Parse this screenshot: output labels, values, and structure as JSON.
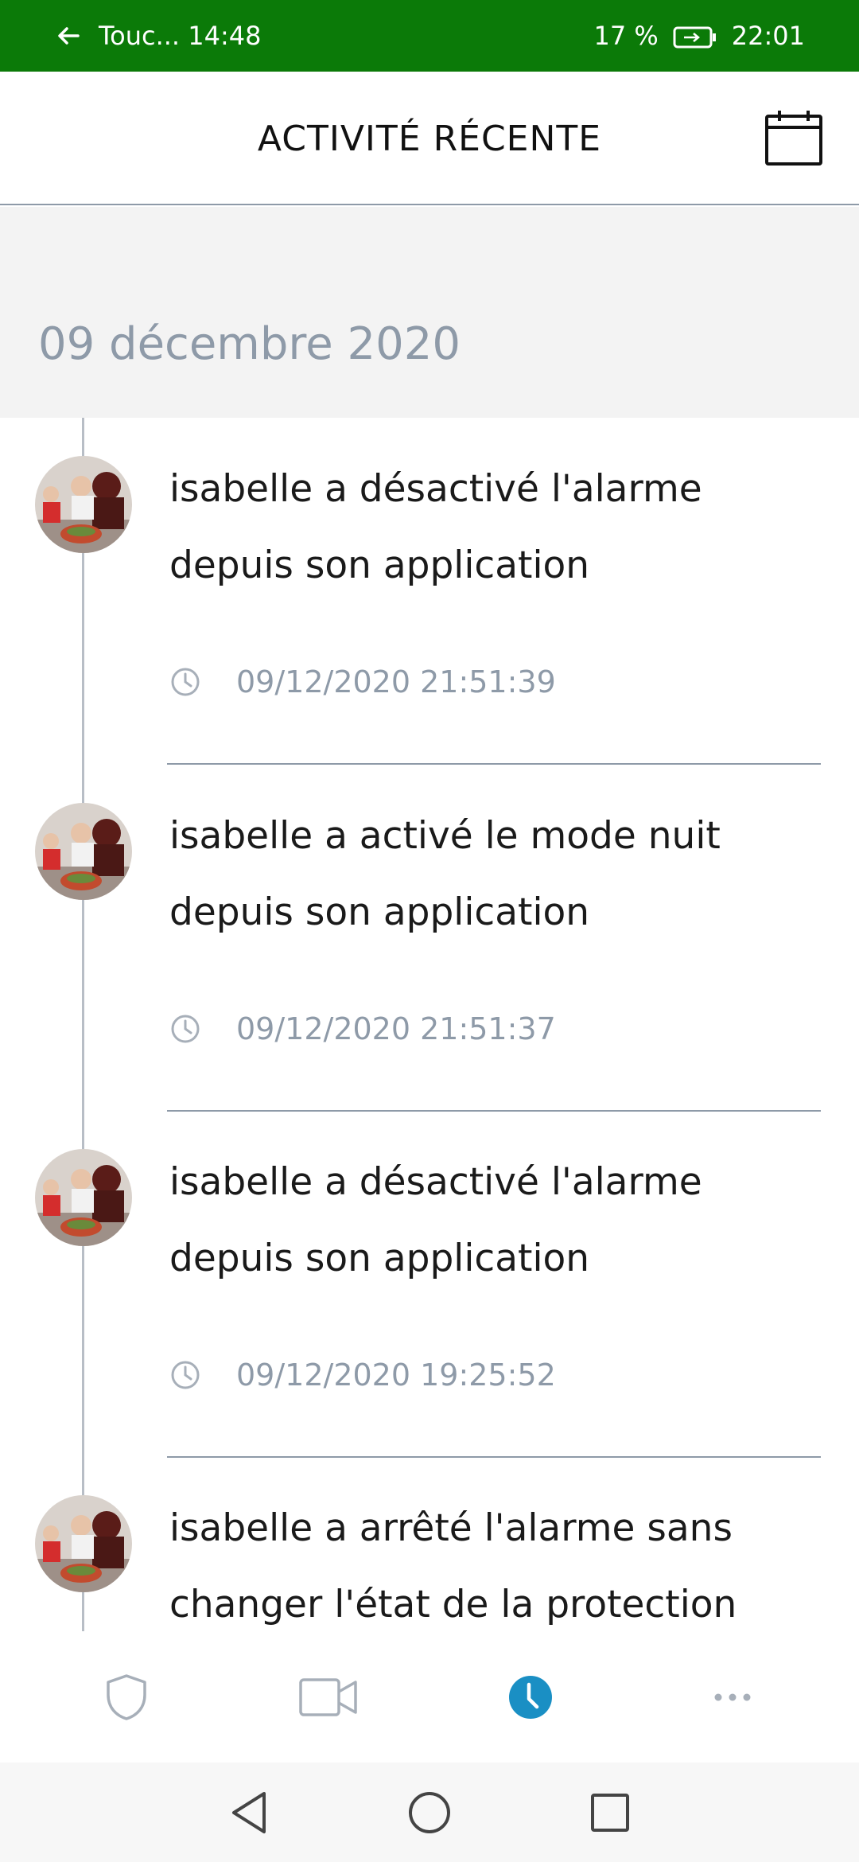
{
  "status_bar": {
    "left_text": "Touc... 14:48",
    "battery": "17 %",
    "time": "22:01",
    "bg_color": "#0b7a08"
  },
  "header": {
    "title": "ACTIVITÉ RÉCENTE",
    "calendar_icon": "calendar-icon"
  },
  "date_section": {
    "label": "09 décembre 2020"
  },
  "events": [
    {
      "text": "isabelle a désactivé l'alarme depuis son application",
      "time": "09/12/2020 21:51:39"
    },
    {
      "text": "isabelle a activé le mode nuit depuis son application",
      "time": "09/12/2020 21:51:37"
    },
    {
      "text": "isabelle a désactivé l'alarme depuis son application",
      "time": "09/12/2020 19:25:52"
    },
    {
      "text": "isabelle a arrêté l'alarme sans changer l'état de la protection",
      "time": ""
    }
  ],
  "tabs": [
    {
      "icon": "shield-icon",
      "active": false
    },
    {
      "icon": "camera-icon",
      "active": false
    },
    {
      "icon": "clock-icon",
      "active": true
    },
    {
      "icon": "more-icon",
      "active": false
    }
  ],
  "colors": {
    "accent": "#1a8fc4",
    "muted": "#8e9aa8",
    "inactive_icon": "#a7afb9"
  }
}
